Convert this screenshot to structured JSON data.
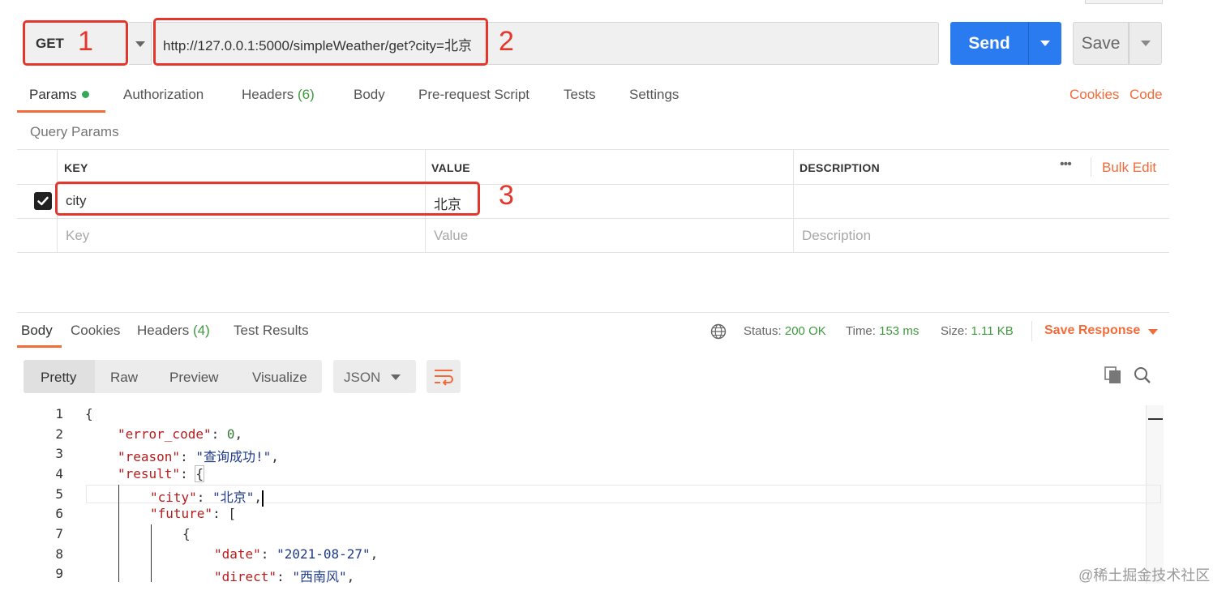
{
  "request": {
    "method": "GET",
    "url": "http://127.0.0.1:5000/simpleWeather/get?city=北京",
    "send_label": "Send",
    "save_label": "Save"
  },
  "annotations": [
    "1",
    "2",
    "3"
  ],
  "request_tabs": {
    "params": "Params",
    "authorization": "Authorization",
    "headers": "Headers",
    "headers_count": "(6)",
    "body": "Body",
    "pre_request": "Pre-request Script",
    "tests": "Tests",
    "settings": "Settings",
    "cookies": "Cookies",
    "code": "Code"
  },
  "query_params": {
    "title": "Query Params",
    "columns": [
      "KEY",
      "VALUE",
      "DESCRIPTION"
    ],
    "more": "•••",
    "bulk_edit": "Bulk Edit",
    "rows": [
      {
        "key": "city",
        "value": "北京",
        "checked": true
      }
    ],
    "placeholders": {
      "key": "Key",
      "value": "Value",
      "description": "Description"
    }
  },
  "response": {
    "tabs": {
      "body": "Body",
      "cookies": "Cookies",
      "headers": "Headers",
      "headers_count": "(4)",
      "test_results": "Test Results"
    },
    "status_label": "Status:",
    "status_value": "200 OK",
    "time_label": "Time:",
    "time_value": "153 ms",
    "size_label": "Size:",
    "size_value": "1.11 KB",
    "save_response": "Save Response",
    "views": [
      "Pretty",
      "Raw",
      "Preview",
      "Visualize"
    ],
    "format": "JSON",
    "line_numbers": [
      "1",
      "2",
      "3",
      "4",
      "5",
      "6",
      "7",
      "8",
      "9"
    ],
    "code": {
      "l1": "{",
      "error_code_key": "\"error_code\"",
      "error_code_val": "0",
      "reason_key": "\"reason\"",
      "reason_val": "\"查询成功!\"",
      "result_key": "\"result\"",
      "brace_open": "{",
      "city_key": "\"city\"",
      "city_val": "\"北京\"",
      "future_key": "\"future\"",
      "bracket_open": "[",
      "brace2": "{",
      "date_key": "\"date\"",
      "date_val": "\"2021-08-27\"",
      "direct_key": "\"direct\"",
      "direct_val": "\"西南风\""
    }
  },
  "watermark": "@稀土掘金技术社区"
}
